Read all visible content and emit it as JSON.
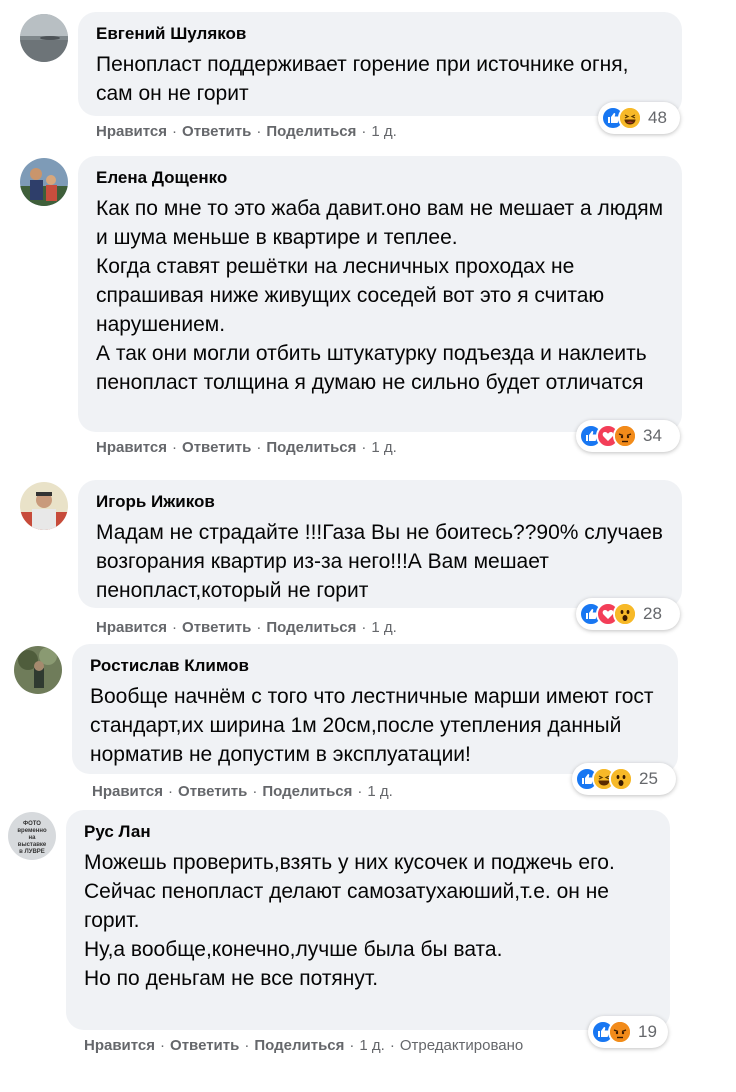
{
  "comments": [
    {
      "author": "Евгений Шуляков",
      "text": "Пенопласт поддерживает горение при источнике огня, сам он не горит",
      "reactions": [
        "like-icon",
        "haha-icon"
      ],
      "reaction_count": "48",
      "actions": {
        "like": "Нравится",
        "reply": "Ответить",
        "share": "Поделиться",
        "time": "1 д."
      }
    },
    {
      "author": "Елена Дощенко",
      "text": "Как по мне то это жаба давит.оно вам не мешает а людям и шума меньше в квартире и теплее.\nКогда ставят решётки на лесничных проходах не спрашивая ниже живущих соседей вот это я считаю нарушением.\nА так они могли отбить штукатурку подъезда и наклеить пенопласт толщина я думаю не сильно будет отличатся",
      "reactions": [
        "like-icon",
        "love-icon",
        "angry-icon"
      ],
      "reaction_count": "34",
      "actions": {
        "like": "Нравится",
        "reply": "Ответить",
        "share": "Поделиться",
        "time": "1 д."
      }
    },
    {
      "author": "Игорь Ижиков",
      "text": "Мадам не страдайте !!!Газа Вы не боитесь??90% случаев возгорания квартир из-за него!!!А Вам мешает пенопласт,который не горит",
      "reactions": [
        "like-icon",
        "love-icon",
        "wow-icon"
      ],
      "reaction_count": "28",
      "actions": {
        "like": "Нравится",
        "reply": "Ответить",
        "share": "Поделиться",
        "time": "1 д."
      }
    },
    {
      "author": "Ростислав Климов",
      "text": "Вообще начнём с того что лестничные марши имеют гост стандарт,их ширина 1м 20см,после утепления данный норматив не допустим в эксплуатации!",
      "reactions": [
        "like-icon",
        "haha-icon",
        "wow-icon"
      ],
      "reaction_count": "25",
      "actions": {
        "like": "Нравится",
        "reply": "Ответить",
        "share": "Поделиться",
        "time": "1 д."
      }
    },
    {
      "author": "Рус Лан",
      "text": "Можешь проверить,взять у них кусочек и поджечь его.\nСейчас пенопласт делают самозатухаюший,т.е. он не горит.\nНу,а вообще,конечно,лучше была бы вата.\nНо по деньгам не все потянут.",
      "avatar_text": "ФОТО временно на выставке в ЛУВРЕ",
      "reactions": [
        "like-icon",
        "angry-icon"
      ],
      "reaction_count": "19",
      "actions": {
        "like": "Нравится",
        "reply": "Ответить",
        "share": "Поделиться",
        "time": "1 д.",
        "edited": "Отредактировано"
      }
    }
  ],
  "colors": {
    "bubble": "#f0f2f5",
    "meta_text": "#65676b",
    "like": "#1877f2",
    "love": "#f33e58",
    "haha": "#f7b928"
  }
}
